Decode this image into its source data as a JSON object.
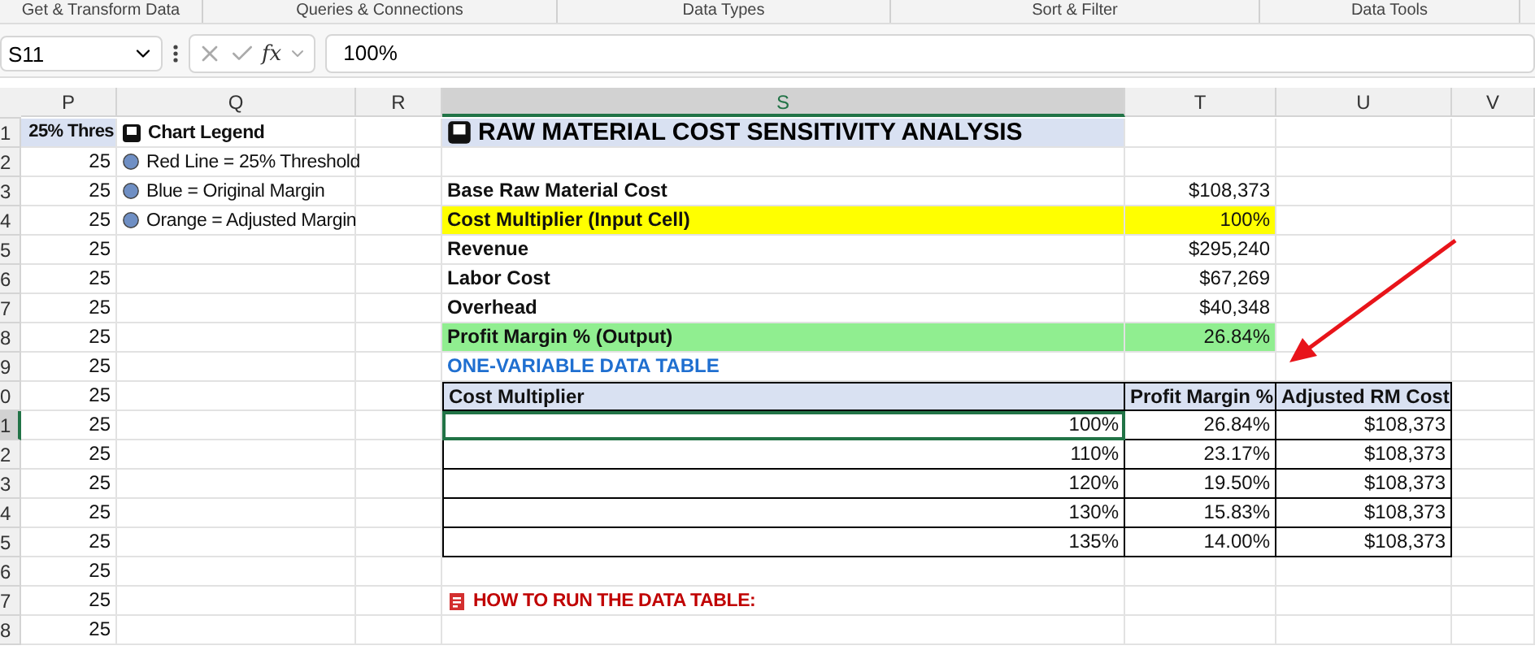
{
  "ribbon_groups": [
    "Get & Transform Data",
    "Queries & Connections",
    "Data Types",
    "Sort & Filter",
    "Data Tools"
  ],
  "formula_bar": {
    "name_box": "S11",
    "formula_button": "fx",
    "value": "100%"
  },
  "columns": [
    {
      "label": "P",
      "selected": false
    },
    {
      "label": "Q",
      "selected": false
    },
    {
      "label": "R",
      "selected": false
    },
    {
      "label": "S",
      "selected": true
    },
    {
      "label": "T",
      "selected": false
    },
    {
      "label": "U",
      "selected": false
    },
    {
      "label": "V",
      "selected": false
    }
  ],
  "rows": [
    {
      "n": "1",
      "kind": "title",
      "selected": false,
      "p": "25% Thres",
      "q": {
        "kind": "heading",
        "text": "Chart Legend"
      },
      "s": "RAW MATERIAL COST SENSITIVITY ANALYSIS"
    },
    {
      "n": "2",
      "kind": "blank",
      "selected": false,
      "p": "25",
      "q": {
        "kind": "legend",
        "text": "Red Line = 25% Threshold"
      }
    },
    {
      "n": "3",
      "kind": "label",
      "selected": false,
      "p": "25",
      "q": {
        "kind": "legend",
        "text": "Blue = Original Margin"
      },
      "s": "Base Raw Material Cost",
      "t": "$108,373"
    },
    {
      "n": "4",
      "kind": "input",
      "selected": false,
      "p": "25",
      "q": {
        "kind": "legend",
        "text": "Orange = Adjusted Margin"
      },
      "s": "Cost Multiplier (Input Cell)",
      "t": "100%"
    },
    {
      "n": "5",
      "kind": "label",
      "selected": false,
      "p": "25",
      "s": "Revenue",
      "t": "$295,240"
    },
    {
      "n": "6",
      "kind": "label",
      "selected": false,
      "p": "25",
      "s": "Labor Cost",
      "t": "$67,269"
    },
    {
      "n": "7",
      "kind": "label",
      "selected": false,
      "p": "25",
      "s": "Overhead",
      "t": "$40,348"
    },
    {
      "n": "8",
      "kind": "output",
      "selected": false,
      "p": "25",
      "s": "Profit Margin % (Output)",
      "t": "26.84%"
    },
    {
      "n": "9",
      "kind": "section",
      "selected": false,
      "p": "25",
      "s": "ONE-VARIABLE DATA TABLE"
    },
    {
      "n": "0",
      "kind": "table-head",
      "selected": false,
      "p": "25",
      "s": "Cost Multiplier",
      "t": "Profit Margin %",
      "u": "Adjusted RM Cost"
    },
    {
      "n": "1",
      "kind": "table-row",
      "selected": true,
      "p": "25",
      "s": "100%",
      "t": "26.84%",
      "u": "$108,373"
    },
    {
      "n": "2",
      "kind": "table-row",
      "selected": false,
      "p": "25",
      "s": "110%",
      "t": "23.17%",
      "u": "$108,373"
    },
    {
      "n": "3",
      "kind": "table-row",
      "selected": false,
      "p": "25",
      "s": "120%",
      "t": "19.50%",
      "u": "$108,373"
    },
    {
      "n": "4",
      "kind": "table-row",
      "selected": false,
      "p": "25",
      "s": "130%",
      "t": "15.83%",
      "u": "$108,373"
    },
    {
      "n": "5",
      "kind": "table-row",
      "selected": false,
      "p": "25",
      "s": "135%",
      "t": "14.00%",
      "u": "$108,373"
    },
    {
      "n": "6",
      "kind": "blank",
      "selected": false,
      "p": "25"
    },
    {
      "n": "7",
      "kind": "note",
      "selected": false,
      "p": "25",
      "s": "HOW TO RUN THE DATA TABLE:"
    },
    {
      "n": "8",
      "kind": "blank",
      "selected": false,
      "p": "25"
    }
  ]
}
